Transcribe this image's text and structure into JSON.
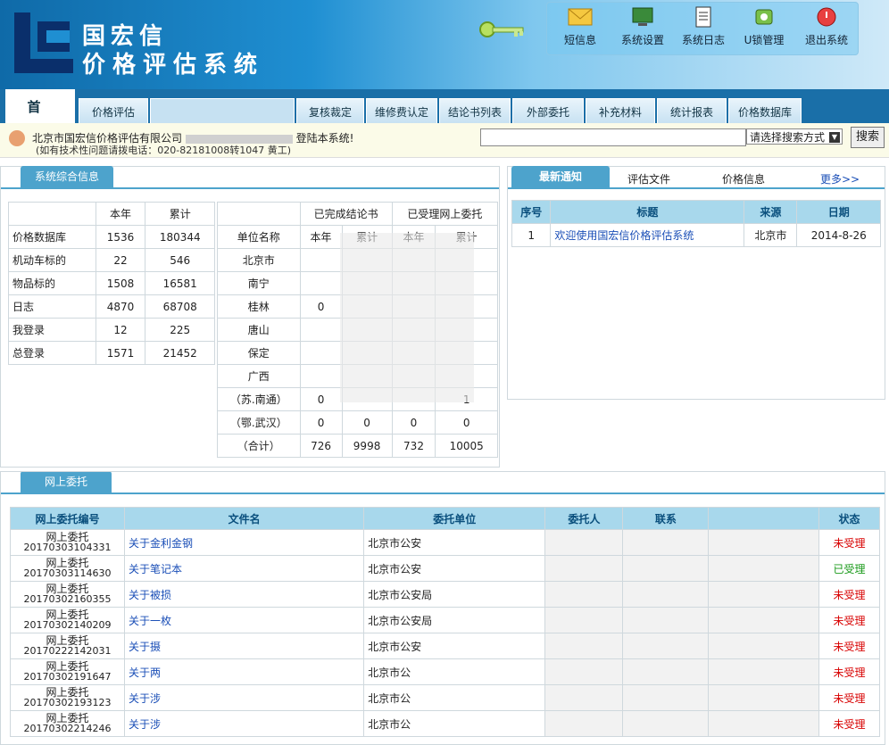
{
  "brand": {
    "line1": "国宏信",
    "line2": "价格评估系统"
  },
  "toolbar": [
    {
      "label": "短信息",
      "icon": "envelope-icon"
    },
    {
      "label": "系统设置",
      "icon": "monitor-icon"
    },
    {
      "label": "系统日志",
      "icon": "clipboard-icon"
    },
    {
      "label": "U锁管理",
      "icon": "usb-key-icon"
    },
    {
      "label": "退出系统",
      "icon": "power-icon"
    }
  ],
  "tabs": [
    "首 页",
    "价格评估",
    "复核裁定",
    "维修费认定",
    "结论书列表",
    "外部委托",
    "补充材料",
    "统计报表",
    "价格数据库"
  ],
  "info": {
    "company": "北京市国宏信价格评估有限公司",
    "welcome_tail": "登陆本系统!",
    "support": "(如有技术性问题请拨电话：020-82181008转1047 黄工)"
  },
  "search": {
    "placeholder": "",
    "select_label": "请选择搜索方式",
    "button": "搜索"
  },
  "overview": {
    "title": "系统综合信息",
    "left_headers": [
      "",
      "本年",
      "累计"
    ],
    "left_rows": [
      [
        "价格数据库",
        "1536",
        "180344"
      ],
      [
        "机动车标的",
        "22",
        "546"
      ],
      [
        "物品标的",
        "1508",
        "16581"
      ],
      [
        "日志",
        "4870",
        "68708"
      ],
      [
        "我登录",
        "12",
        "225"
      ],
      [
        "总登录",
        "1571",
        "21452"
      ]
    ],
    "right_group_headers": [
      "已完成结论书",
      "已受理网上委托"
    ],
    "right_sub_headers": [
      "单位名称",
      "本年",
      "累计",
      "本年",
      "累计"
    ],
    "right_rows": [
      [
        "北京市",
        "",
        "",
        "",
        ""
      ],
      [
        "南宁",
        "",
        "",
        "",
        ""
      ],
      [
        "桂林",
        "0",
        "",
        "",
        ""
      ],
      [
        "唐山",
        "",
        "",
        "",
        ""
      ],
      [
        "保定",
        "",
        "",
        "",
        ""
      ],
      [
        "广西",
        "",
        "",
        "",
        ""
      ],
      [
        "（苏.南通）",
        "0",
        "",
        "",
        "1"
      ],
      [
        "（鄂.武汉）",
        "0",
        "0",
        "0",
        "0"
      ],
      [
        "（合计）",
        "726",
        "9998",
        "732",
        "10005"
      ]
    ]
  },
  "notice": {
    "tabs": [
      "最新通知",
      "评估文件",
      "价格信息",
      "更多>>"
    ],
    "headers": [
      "序号",
      "标题",
      "来源",
      "日期"
    ],
    "rows": [
      [
        "1",
        "欢迎使用国宏信价格评估系统",
        "北京市",
        "2014-8-26"
      ]
    ]
  },
  "delegation": {
    "title": "网上委托",
    "headers": [
      "网上委托编号",
      "文件名",
      "委托单位",
      "委托人",
      "联系",
      "",
      "状态"
    ],
    "rows": [
      {
        "label": "网上委托",
        "id": "20170303104331",
        "file": "关于金利金钢",
        "unit": "北京市公安",
        "status": "未受理",
        "state": "red"
      },
      {
        "label": "网上委托",
        "id": "20170303114630",
        "file": "关于笔记本",
        "unit": "北京市公安",
        "status": "已受理",
        "state": "green"
      },
      {
        "label": "网上委托",
        "id": "20170302160355",
        "file": "关于被损",
        "unit": "北京市公安局",
        "status": "未受理",
        "state": "red"
      },
      {
        "label": "网上委托",
        "id": "20170302140209",
        "file": "关于一枚",
        "unit": "北京市公安局",
        "status": "未受理",
        "state": "red"
      },
      {
        "label": "网上委托",
        "id": "20170222142031",
        "file": "关于摄",
        "unit": "北京市公安",
        "status": "未受理",
        "state": "red"
      },
      {
        "label": "网上委托",
        "id": "20170302191647",
        "file": "关于两",
        "unit": "北京市公",
        "status": "未受理",
        "state": "red"
      },
      {
        "label": "网上委托",
        "id": "20170302193123",
        "file": "关于涉",
        "unit": "北京市公",
        "status": "未受理",
        "state": "red"
      },
      {
        "label": "网上委托",
        "id": "20170302214246",
        "file": "关于涉",
        "unit": "北京市公",
        "status": "未受理",
        "state": "red"
      }
    ]
  }
}
